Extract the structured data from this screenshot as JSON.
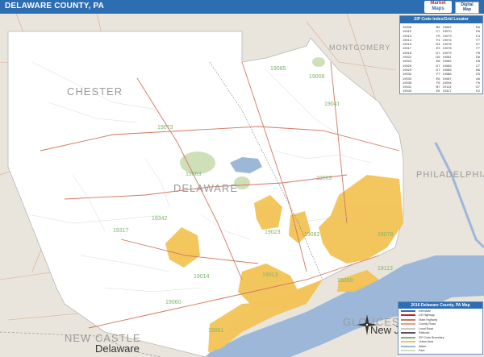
{
  "header": {
    "title": "DELAWARE COUNTY, PA",
    "logo_line1": "Market",
    "logo_line2": "Maps",
    "badge_line1": "Digital",
    "badge_line2": "Map"
  },
  "map_labels": {
    "counties": [
      "CHESTER",
      "MONTGOMERY",
      "PHILADELPHIA",
      "DELAWARE",
      "NEW CASTLE",
      "GLOUCESTER"
    ],
    "states": [
      "Delaware",
      "New Je"
    ]
  },
  "zip_labels": [
    "19073",
    "19085",
    "19008",
    "19063",
    "19342",
    "19317",
    "19014",
    "19060",
    "19061",
    "19013",
    "19113",
    "19078",
    "19041",
    "19083",
    "19082",
    "19050",
    "19023"
  ],
  "index": {
    "title": "ZIP Code Index/Grid Locator",
    "rows": [
      [
        "19008",
        "B4",
        "19064",
        "D6"
      ],
      [
        "19010",
        "C7",
        "19070",
        "E6"
      ],
      [
        "19013",
        "F5",
        "19073",
        "C4"
      ],
      [
        "19014",
        "F4",
        "19074",
        "F7"
      ],
      [
        "19015",
        "G4",
        "19076",
        "E7"
      ],
      [
        "19017",
        "E3",
        "19078",
        "F7"
      ],
      [
        "19018",
        "D7",
        "19079",
        "F8"
      ],
      [
        "19022",
        "G5",
        "19081",
        "D6"
      ],
      [
        "19023",
        "E8",
        "19082",
        "E8"
      ],
      [
        "19026",
        "D7",
        "19083",
        "C7"
      ],
      [
        "19029",
        "G7",
        "19085",
        "B6"
      ],
      [
        "19032",
        "F7",
        "19086",
        "E5"
      ],
      [
        "19033",
        "E6",
        "19087",
        "A6"
      ],
      [
        "19036",
        "F6",
        "19094",
        "F6"
      ],
      [
        "19041",
        "B7",
        "19113",
        "G7"
      ],
      [
        "19043",
        "E6",
        "19317",
        "E2"
      ]
    ]
  },
  "legend": {
    "title": "2016 Delaware County, PA Map",
    "items": [
      "Interstate",
      "US Highway",
      "State Highway",
      "County Road",
      "Local Road",
      "Railroad",
      "ZIP Code Boundary",
      "Urban Area",
      "Water",
      "Park"
    ]
  },
  "colors": {
    "title_bar": "#2d6db1",
    "county_fill": "#ffffff",
    "surrounding": "#e9e5dc",
    "urban": "#f3c355",
    "water": "#9db7d9",
    "park": "#cfe0b8",
    "roads": "#d59a8a",
    "zip_text": "#7fb36b"
  },
  "icons": [
    "compass-icon"
  ]
}
